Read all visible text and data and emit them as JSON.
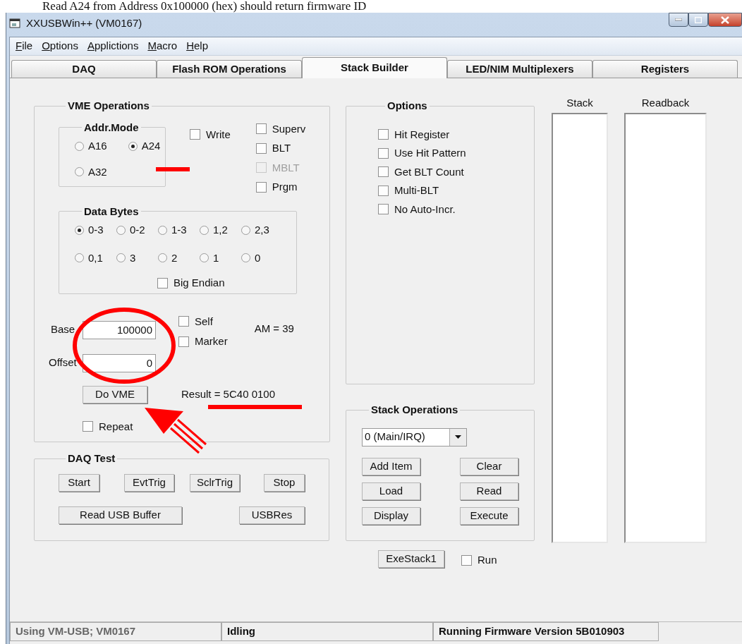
{
  "caption": "Read A24 from Address 0x100000 (hex) should return firmware ID",
  "window": {
    "title": "XXUSBWin++ (VM0167)"
  },
  "menu": [
    {
      "label": "File"
    },
    {
      "label": "Options"
    },
    {
      "label": "Applictions"
    },
    {
      "label": "Macro"
    },
    {
      "label": "Help"
    }
  ],
  "tabs": [
    {
      "label": "DAQ",
      "selected": false
    },
    {
      "label": "Flash ROM Operations",
      "selected": false
    },
    {
      "label": "Stack Builder",
      "selected": true
    },
    {
      "label": "LED/NIM Multiplexers",
      "selected": false
    },
    {
      "label": "Registers",
      "selected": false
    }
  ],
  "vme_operations": {
    "title": "VME Operations",
    "addr_mode": {
      "title": "Addr.Mode",
      "options": [
        {
          "label": "A16",
          "selected": false
        },
        {
          "label": "A24",
          "selected": true
        },
        {
          "label": "A32",
          "selected": false
        }
      ]
    },
    "write": {
      "label": "Write",
      "checked": false,
      "disabled": false
    },
    "flags": [
      {
        "label": "Superv",
        "checked": false,
        "disabled": false
      },
      {
        "label": "BLT",
        "checked": false,
        "disabled": false
      },
      {
        "label": "MBLT",
        "checked": false,
        "disabled": true
      },
      {
        "label": "Prgm",
        "checked": false,
        "disabled": false
      }
    ],
    "data_bytes": {
      "title": "Data Bytes",
      "options": [
        {
          "label": "0-3",
          "selected": true
        },
        {
          "label": "0-2",
          "selected": false
        },
        {
          "label": "1-3",
          "selected": false
        },
        {
          "label": "1,2",
          "selected": false
        },
        {
          "label": "2,3",
          "selected": false
        },
        {
          "label": "0,1",
          "selected": false
        },
        {
          "label": "3",
          "selected": false
        },
        {
          "label": "2",
          "selected": false
        },
        {
          "label": "1",
          "selected": false
        },
        {
          "label": "0",
          "selected": false
        }
      ],
      "big_endian": {
        "label": "Big Endian",
        "checked": false,
        "disabled": false
      }
    },
    "base": {
      "label": "Base",
      "value": "100000"
    },
    "self": {
      "label": "Self",
      "checked": false,
      "disabled": false
    },
    "marker": {
      "label": "Marker",
      "checked": false,
      "disabled": false
    },
    "am": "AM = 39",
    "offset": {
      "label": "Offset",
      "value": "0"
    },
    "do_vme": "Do VME",
    "result": "Result = 5C40 0100",
    "repeat": {
      "label": "Repeat",
      "checked": false,
      "disabled": false
    }
  },
  "daq_test": {
    "title": "DAQ Test",
    "buttons": [
      "Start",
      "EvtTrig",
      "SclrTrig",
      "Stop",
      "Read USB Buffer",
      "USBRes"
    ]
  },
  "options": {
    "title": "Options",
    "items": [
      {
        "label": "Hit Register",
        "checked": false,
        "disabled": false
      },
      {
        "label": "Use Hit Pattern",
        "checked": false,
        "disabled": false
      },
      {
        "label": "Get BLT Count",
        "checked": false,
        "disabled": false
      },
      {
        "label": "Multi-BLT",
        "checked": false,
        "disabled": false
      },
      {
        "label": "No Auto-Incr.",
        "checked": false,
        "disabled": false
      }
    ]
  },
  "stack_operations": {
    "title": "Stack Operations",
    "select": "0 (Main/IRQ)",
    "buttons": [
      "Add Item",
      "Clear",
      "Load",
      "Read",
      "Display",
      "Execute"
    ]
  },
  "exe_stack": "ExeStack1",
  "run": {
    "label": "Run",
    "checked": false,
    "disabled": false
  },
  "stack": {
    "label": "Stack"
  },
  "readback": {
    "label": "Readback"
  },
  "status_bar": [
    "Using VM-USB; VM0167",
    "Idling",
    "Running Firmware Version 5B010903"
  ]
}
